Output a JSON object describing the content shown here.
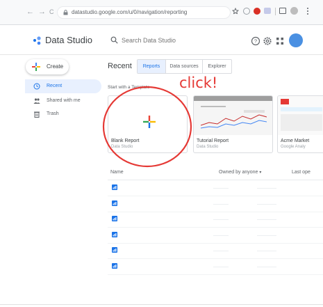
{
  "browser": {
    "url": "datastudio.google.com/u/0/navigation/reporting",
    "nav_back": "←",
    "nav_forward": "→",
    "nav_reload": "C"
  },
  "app": {
    "title": "Data Studio",
    "search_placeholder": "Search Data Studio"
  },
  "sidebar": {
    "create_label": "Create",
    "items": [
      {
        "label": "Recent",
        "icon": "clock-icon",
        "active": true
      },
      {
        "label": "Shared with me",
        "icon": "people-icon",
        "active": false
      },
      {
        "label": "Trash",
        "icon": "trash-icon",
        "active": false
      }
    ]
  },
  "main": {
    "title": "Recent",
    "tabs": [
      {
        "label": "Reports",
        "active": true
      },
      {
        "label": "Data sources",
        "active": false
      },
      {
        "label": "Explorer",
        "active": false
      }
    ],
    "start_label": "Start with a Template",
    "annotation": "click!",
    "templates": [
      {
        "title": "Blank Report",
        "subtitle": "Data Studio"
      },
      {
        "title": "Tutorial Report",
        "subtitle": "Data Studio"
      },
      {
        "title": "Acme Market",
        "subtitle": "Google Analy"
      }
    ],
    "columns": {
      "name": "Name",
      "owner": "Owned by anyone",
      "last": "Last ope"
    },
    "file_rows": 6
  },
  "colors": {
    "accent": "#1a73e8",
    "annotation": "#e53935"
  }
}
